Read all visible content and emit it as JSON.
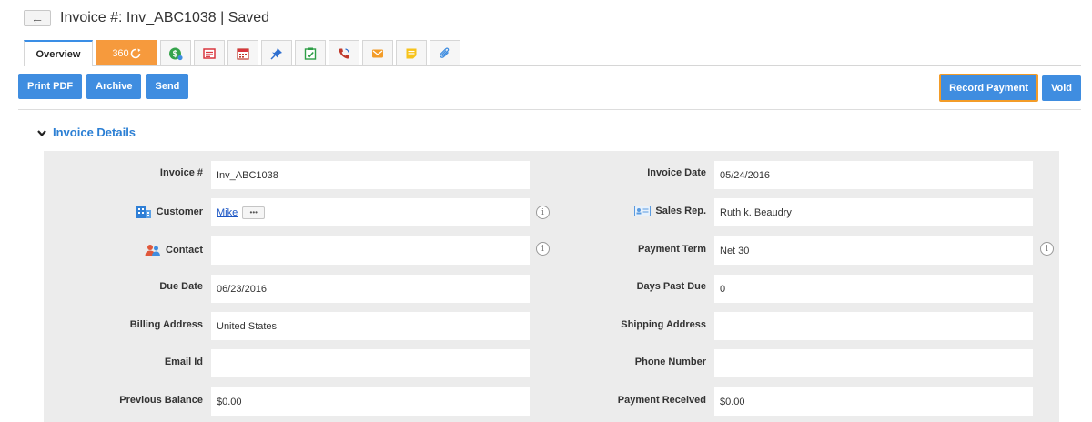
{
  "header": {
    "back_label": "←",
    "title": "Invoice #: Inv_ABC1038 | Saved"
  },
  "tabs": [
    {
      "label": "Overview",
      "icon": "overview"
    },
    {
      "label": "360",
      "icon": "360-icon"
    },
    {
      "icon": "dollar-icon"
    },
    {
      "icon": "invoice-icon"
    },
    {
      "icon": "calendar-icon"
    },
    {
      "icon": "pin-icon"
    },
    {
      "icon": "checklist-icon"
    },
    {
      "icon": "phone-icon"
    },
    {
      "icon": "email-icon"
    },
    {
      "icon": "note-icon"
    },
    {
      "icon": "attachment-icon"
    }
  ],
  "toolbar": {
    "print_pdf": "Print PDF",
    "archive": "Archive",
    "send": "Send",
    "record_payment": "Record Payment",
    "void": "Void"
  },
  "section": {
    "title": "Invoice Details"
  },
  "fields": {
    "invoice_no": {
      "label": "Invoice #",
      "value": "Inv_ABC1038"
    },
    "customer": {
      "label": "Customer",
      "value": "Mike",
      "more": "•••"
    },
    "contact": {
      "label": "Contact",
      "value": ""
    },
    "due_date": {
      "label": "Due Date",
      "value": "06/23/2016"
    },
    "billing_address": {
      "label": "Billing Address",
      "value": "United States"
    },
    "email_id": {
      "label": "Email Id",
      "value": ""
    },
    "previous_balance": {
      "label": "Previous Balance",
      "value": "$0.00"
    },
    "invoice_date": {
      "label": "Invoice Date",
      "value": "05/24/2016"
    },
    "sales_rep": {
      "label": "Sales Rep.",
      "value": "Ruth k. Beaudry"
    },
    "payment_term": {
      "label": "Payment Term",
      "value": "Net 30"
    },
    "days_past_due": {
      "label": "Days Past Due",
      "value": "0"
    },
    "shipping_address": {
      "label": "Shipping Address",
      "value": ""
    },
    "phone_number": {
      "label": "Phone Number",
      "value": ""
    },
    "payment_received": {
      "label": "Payment Received",
      "value": "$0.00"
    }
  },
  "info_glyph": "i",
  "colors": {
    "accent": "#3f8de0",
    "highlight": "#f39c28",
    "tab_360": "#f69a3d",
    "section_title": "#2b7fd4",
    "panel": "#ececec"
  }
}
